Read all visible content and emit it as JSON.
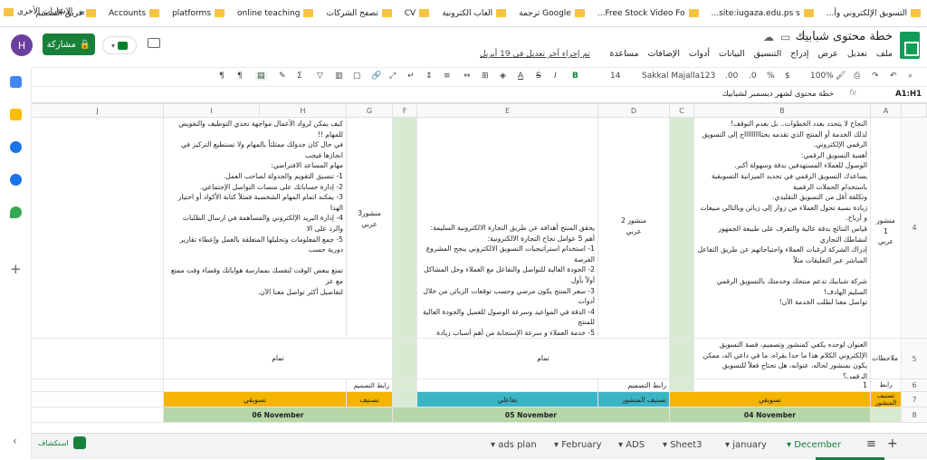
{
  "bookmarks": [
    {
      "label": "التسويق الإلكتروني وأ..."
    },
    {
      "label": "site:iugaza.edu.ps s..."
    },
    {
      "label": "Free Stock Video Fo..."
    },
    {
      "label": "Google ترجمة"
    },
    {
      "label": "العاب الكترونية"
    },
    {
      "label": "CV"
    },
    {
      "label": "تصفح الشركات"
    },
    {
      "label": "online teaching"
    },
    {
      "label": "platforms"
    },
    {
      "label": "Accounts"
    },
    {
      "label": "فريق التصميم"
    }
  ],
  "bookmarks_more": "»",
  "bookmarks_other": "الإشارات الأخرى",
  "doc": {
    "title": "خطة محتوى شبابيك",
    "last_edit": "تم إجراء آخر تعديل في 19 أبريل"
  },
  "menu": [
    "ملف",
    "تعديل",
    "عرض",
    "إدراج",
    "التنسيق",
    "البيانات",
    "أدوات",
    "الإضافات",
    "مساعدة"
  ],
  "account": {
    "avatar_letter": "H",
    "share_label": "مشاركة"
  },
  "toolbar": {
    "zoom": "100%",
    "currency": "$",
    "percent": "%",
    "dec1": ".0",
    "dec2": ".00",
    "format_num": "123",
    "font": "Sakkal Majalla",
    "font_size": "14",
    "bold": "B",
    "italic": "I",
    "strike": "S",
    "text_a": "A"
  },
  "formula": {
    "ref": "A1:H1",
    "fx": "fx",
    "content": "خطة محتوى لشهر ديسمبر لشبابيك"
  },
  "columns": [
    "A",
    "B",
    "C",
    "D",
    "E",
    "F",
    "G",
    "H",
    "I",
    "J"
  ],
  "rows": [
    "4",
    "5",
    "6",
    "7",
    "8"
  ],
  "cells": {
    "a4": "منشور 1\nعربي",
    "b4": "النجاح لا يتحدد بعدد الخطوات.. بل بعدم التوقف!\nلذلك الخدمة أو المنتج الذي تقدمه يحتاااااااااج إلى التسويق الرقمي الإلكتروني.\nأهمية التسويق الرقمي:\nالوصول للعملاء المستهدفين بدقة وسهولة أكبر.\nيساعدك التسويق الرقمي في تحديد الميزانية التسويقية باستخدام الحملات الرقمية\nوتكلفة أقل من التسويق التقليدي.\nزيادة نسبة تحول العملاء من زوار إلى زبائن وبالتالي مبيعات و أرباح.\nقياس النتائج بدقة عالية والتعرف على طبيعة الجمهور لنشاطك التجاري\nإدراك الشركة لرغبات العملاء واحتياجاتهم عن طريق التفاعل المباشر عبر التعليقات مثلاً\n\nشركة شبابيك تدعم منتجك وخدمتك بالتسويق الرقمي السليم الهادف!\nتواصل معنا لطلب الخدمة الآن!",
    "d4": "منشور 2\nعربي",
    "e4": "يحقق المنتج أهدافه عن طريق التجارة الالكترونية السليمة:\nأهم 5 عوامل نجاح التجارة الالكترونية:\n1- استخدام استراتيجيات التسويق الالكتروني ينجح المشروع الفرصة\n2- الجودة العالية للتواصل والتفاعل مع العملاء وحل المشاكل أولاً بأول\n3- سعر المنتج يكون مرضي وحسب توقعات الزبائن من خلال أدوات\n4- الدقة في المواعيد وسرعة الوصول للعميل والجودة العالية للمنتج\n5- خدمة العملاء و سرعة الإستجابة من أهم أسباب زيادة الطلب على\n\nشبابيك تفتح لك النافذة لوصول منتجك للجمهور\nالذي تحتاجه بتقنية رقمية و احترافية عالية!",
    "g4": "منشور3\nعربي",
    "h4": "كيف يمكن لرواد الأعمال مواجهة تحدي التوظيف والتفويض للمهام !!\nفي حال كان جدولك ممتلئاً بالمهام ولا تستطيع التركيز في انجازها فيجب\nمهام المساعد الافتراضي:\n1- تنسيق التقويم والجدولة لصاحب العمل.\n2- إدارة حساباتك على منصات التواصل الإجتماعي.\n3- يمكنه اتمام المهام الشخصية فمثلاً كتابة الأكواد أو اختيار الهدا\n4- إدارة البريد الإلكتروني والمساهمة في ارسال الطلبات والرد على الا\n5- جمع المعلومات وتحليلها المتعلقة بالعمل وإعطاء تقارير دورية حسب\n\nتمتع ببعض الوقت لنفسك بممارسة هواياتك وقضاء وقت ممتع مع عز\nلتفاصيل أكثر تواصل معنا الآن.",
    "a5": "ملاحظات",
    "b5": "العنوان لوحده يكفي كمنشور وتصميم، قصة التسويق الإلكتروني الكلام هذا ما حدا بقراه، ما في داعي اله، ممكن يكون بمنشور لحاله، عنوانه، هل تحتاج فعلاً للتسويق الرقمي؟",
    "e5": "تمام",
    "h5": "تمام",
    "a6": "رابط التصميم",
    "b6": "1",
    "d6": "رابط التصميم",
    "g6": "رابط التصميم",
    "a7": "تصنيف المنشور",
    "b7": "تسويقي",
    "d7": "تصنيف المنشور",
    "e7": "تفاعلي",
    "g7": "تصنيف",
    "h7": "تسويقي",
    "b8": "04 November",
    "e8": "05 November",
    "h8": "06 November"
  },
  "colors": {
    "orange": "#f4b400",
    "teal": "#3ab5c4",
    "green_date": "#b6d7a8",
    "light_green": "#d9ead3",
    "brand_green": "#188038"
  },
  "tabs": {
    "add": "+",
    "list": "≡",
    "items": [
      "December",
      "january",
      "Sheet3",
      "ADS",
      "February",
      "ads plan"
    ],
    "explore": "استكشاف"
  }
}
